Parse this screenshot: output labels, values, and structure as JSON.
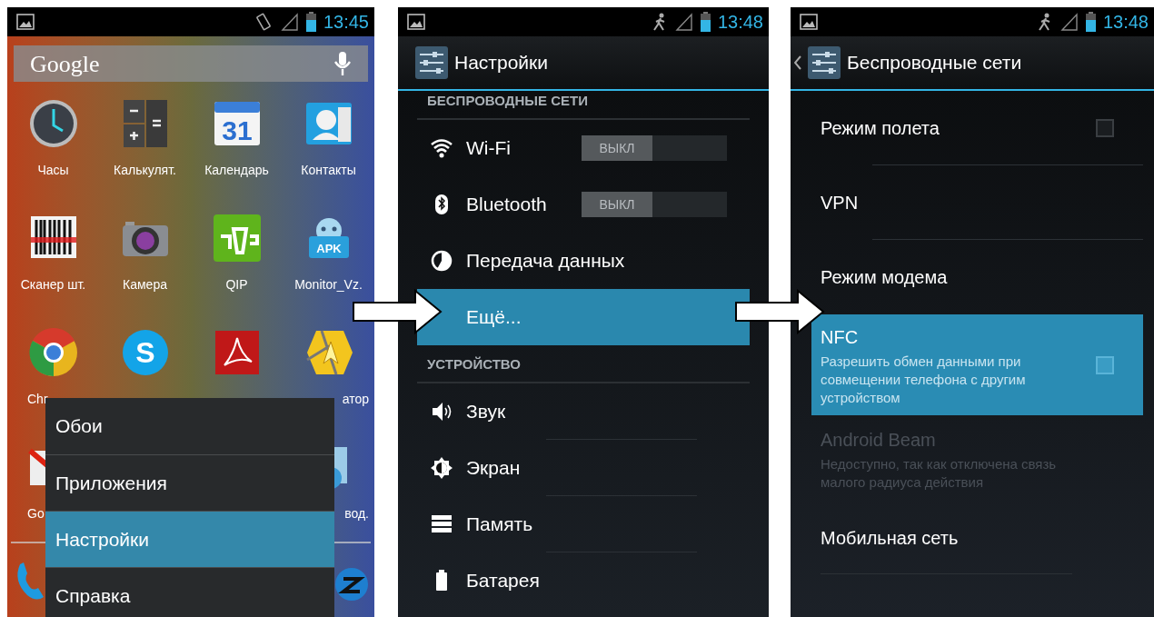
{
  "home_screen": {
    "status_bar": {
      "time": "13:45"
    },
    "search": {
      "logo": "Google"
    },
    "app_rows": [
      [
        {
          "label": "Часы"
        },
        {
          "label": "Калькулят."
        },
        {
          "label": "Календарь",
          "icon_text": "31"
        },
        {
          "label": "Контакты"
        }
      ],
      [
        {
          "label": "Сканер шт."
        },
        {
          "label": "Камера"
        },
        {
          "label": "QIP"
        },
        {
          "label": "Monitor_Vz.",
          "icon_text": "APK"
        }
      ],
      [
        {
          "label": "Chr"
        },
        {
          "icon_text": "S"
        },
        {},
        {
          "label": "атор"
        }
      ],
      [
        {
          "label": "Go"
        },
        {
          "label": "вод."
        }
      ]
    ],
    "menu": {
      "items": [
        {
          "label": "Обои",
          "selected": false
        },
        {
          "label": "Приложения",
          "selected": false
        },
        {
          "label": "Настройки",
          "selected": true
        },
        {
          "label": "Справка",
          "selected": false
        }
      ]
    }
  },
  "settings_screen": {
    "status_bar": {
      "time": "13:48"
    },
    "title": "Настройки",
    "sections": [
      {
        "header": "БЕСПРОВОДНЫЕ СЕТИ",
        "items": [
          {
            "label": "Wi-Fi",
            "kind": "toggle",
            "on": false,
            "toggle_text": "ВЫКЛ",
            "selected": false
          },
          {
            "label": "Bluetooth",
            "kind": "toggle",
            "on": false,
            "toggle_text": "ВЫКЛ",
            "selected": false
          },
          {
            "label": "Передача данных",
            "kind": "link",
            "selected": false
          },
          {
            "label": "Ещё...",
            "kind": "link",
            "selected": true
          }
        ]
      },
      {
        "header": "УСТРОЙСТВО",
        "items": [
          {
            "label": "Звук",
            "kind": "link",
            "selected": false
          },
          {
            "label": "Экран",
            "kind": "link",
            "selected": false
          },
          {
            "label": "Память",
            "kind": "link",
            "selected": false
          },
          {
            "label": "Батарея",
            "kind": "link",
            "selected": false
          }
        ]
      }
    ]
  },
  "wireless_screen": {
    "status_bar": {
      "time": "13:48"
    },
    "title": "Беспроводные сети",
    "items": [
      {
        "label": "Режим полета",
        "kind": "checkbox",
        "checked": false,
        "selected": false,
        "disabled": false
      },
      {
        "label": "VPN",
        "kind": "link",
        "selected": false,
        "disabled": false
      },
      {
        "label": "Режим модема",
        "kind": "link",
        "selected": false,
        "disabled": false
      },
      {
        "label": "NFC",
        "summary": "Разрешить обмен данными при совмещении телефона с другим устройством",
        "kind": "checkbox",
        "checked": false,
        "selected": true,
        "disabled": false
      },
      {
        "label": "Android Beam",
        "summary": "Недоступно, так как отключена связь малого радиуса действия",
        "kind": "link",
        "selected": false,
        "disabled": true
      },
      {
        "label": "Мобильная сеть",
        "kind": "link",
        "selected": false,
        "disabled": false
      }
    ]
  }
}
